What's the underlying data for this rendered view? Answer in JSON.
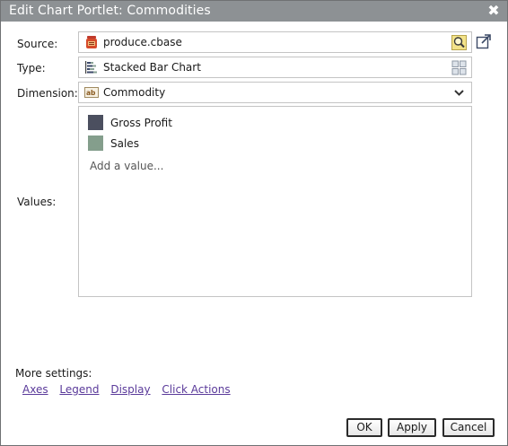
{
  "dialog": {
    "title": "Edit Chart Portlet: Commodities",
    "close_glyph": "✖"
  },
  "form": {
    "source": {
      "label": "Source:",
      "value": "produce.cbase",
      "icon": "cbase-file-icon",
      "button_icon": "search-icon"
    },
    "type": {
      "label": "Type:",
      "value": "Stacked Bar Chart",
      "icon": "stacked-bar-chart-icon",
      "button_icon": "chart-gallery-icon"
    },
    "dimension": {
      "label": "Dimension:",
      "value": "Commodity",
      "icon": "text-field-icon",
      "button_icon": "chevron-down-icon"
    },
    "values": {
      "label": "Values:",
      "items": [
        {
          "label": "Gross Profit",
          "color": "#4b4f5f"
        },
        {
          "label": "Sales",
          "color": "#849e8c"
        }
      ],
      "add_placeholder": "Add a value..."
    }
  },
  "more_settings": {
    "label": "More settings:",
    "links": [
      "Axes",
      "Legend",
      "Display",
      "Click Actions"
    ]
  },
  "buttons": {
    "ok": "OK",
    "apply": "Apply",
    "cancel": "Cancel"
  },
  "colors": {
    "titlebar": "#8d9194",
    "border": "#c4c4c4",
    "link": "#5a3a9a"
  }
}
